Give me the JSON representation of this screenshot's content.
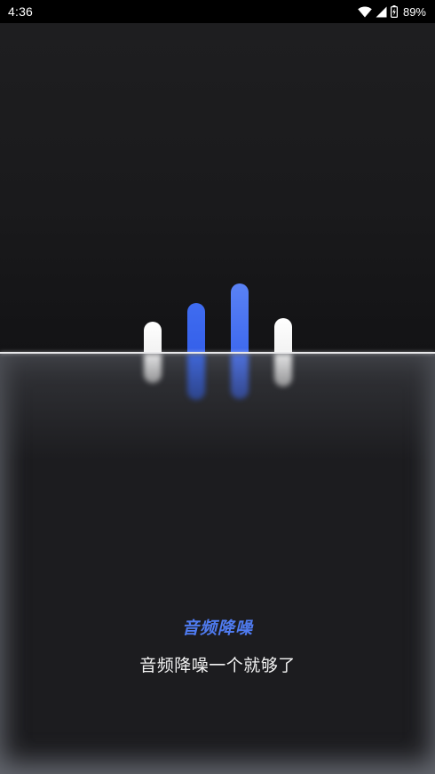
{
  "status_bar": {
    "time": "4:36",
    "battery_percent": "89%",
    "icons": [
      "wifi-icon",
      "cell-signal-icon",
      "battery-icon"
    ]
  },
  "visual": {
    "bars": [
      {
        "color": "#ffffff",
        "level": 0.35
      },
      {
        "color": "#3a64ec",
        "level": 0.56
      },
      {
        "color": "#4f78f2",
        "level": 0.78
      },
      {
        "color": "#ffffff",
        "level": 0.39
      }
    ]
  },
  "content": {
    "title": "音频降噪",
    "subtitle": "音频降噪一个就够了",
    "accent_color": "#4f7bf0"
  }
}
